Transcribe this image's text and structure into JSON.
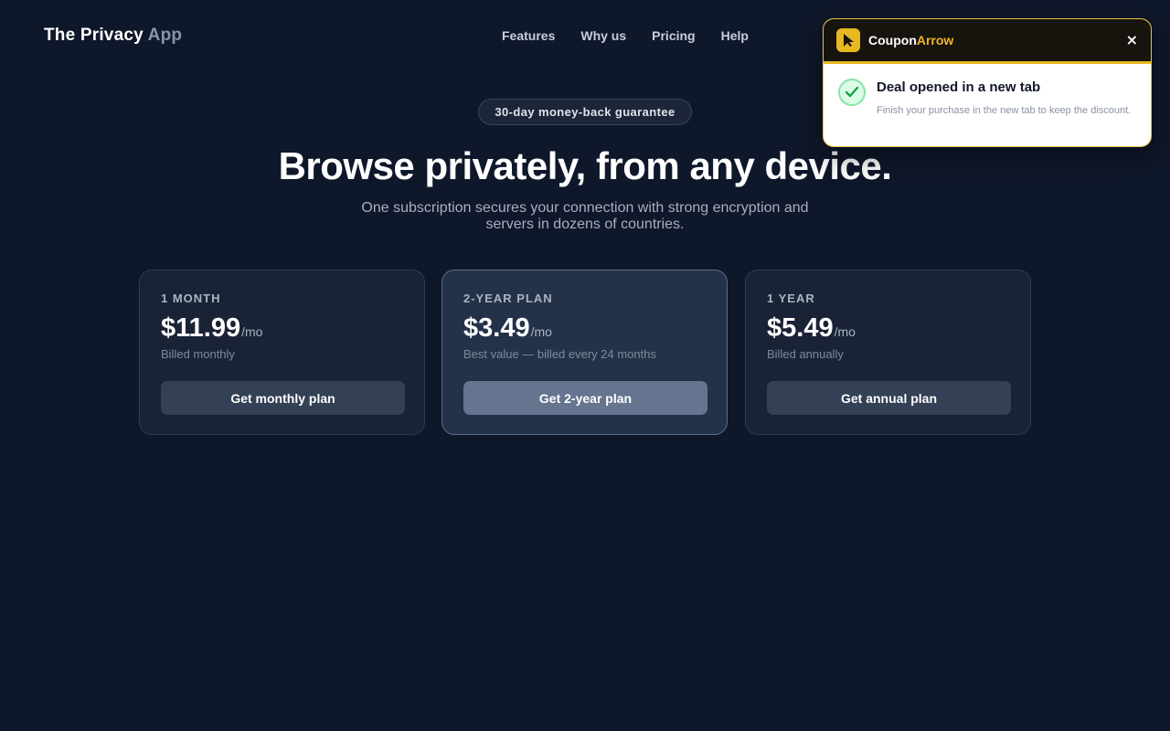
{
  "header": {
    "brand_main": "The Privacy",
    "brand_accent": "App",
    "nav": [
      "Features",
      "Why us",
      "Pricing",
      "Help"
    ]
  },
  "hero": {
    "badge": "30-day money-back guarantee",
    "title": "Browse privately, from any device.",
    "subtitle": "One subscription secures your connection with strong encryption and servers in dozens of countries."
  },
  "plans": [
    {
      "name": "1 MONTH",
      "price": "$11.99",
      "unit": "/mo",
      "note": "Billed monthly",
      "button": "Get monthly plan"
    },
    {
      "name": "2-YEAR PLAN",
      "price": "$3.49",
      "unit": "/mo",
      "note": "Best value — billed every 24 months",
      "button": "Get 2-year plan"
    },
    {
      "name": "1 YEAR",
      "price": "$5.49",
      "unit": "/mo",
      "note": "Billed annually",
      "button": "Get annual plan"
    }
  ],
  "toast": {
    "brand_main": "Coupon",
    "brand_accent": "Arrow",
    "close": "×",
    "title": "Deal opened in a new tab",
    "message": "Finish your purchase in the new tab to keep the discount."
  },
  "colors": {
    "background": "#0f172a",
    "accent_yellow": "#e8b820",
    "success_green": "#16a34a"
  },
  "icons": {
    "toast_logo": "arrow-cursor-icon",
    "toast_status": "check-circle-icon",
    "toast_close": "close-icon"
  }
}
